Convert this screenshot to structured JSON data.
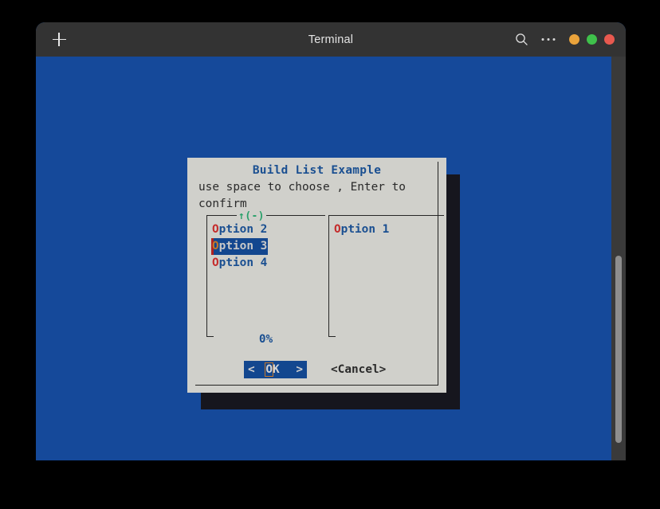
{
  "window": {
    "title": "Terminal",
    "new_tab_icon": "plus-icon",
    "search_icon": "search-icon",
    "menu_icon": "ellipsis-icon",
    "controls": [
      {
        "name": "minimize",
        "color": "#eaa33b"
      },
      {
        "name": "maximize",
        "color": "#3fc14b"
      },
      {
        "name": "close",
        "color": "#e8594f"
      }
    ],
    "background": "#15499a",
    "titlebar_background": "#333333"
  },
  "scrollbar": {
    "track_color": "#3a3a3a",
    "thumb_color": "#8e8e8e"
  },
  "dialog": {
    "title": "Build List Example",
    "prompt": "use space to choose , Enter to\nconfirm",
    "background": "#d0d0cb",
    "title_color": "#1a4f91",
    "left_pane": {
      "tag": "↑(-)",
      "tag_color": "#28a06a",
      "items": [
        {
          "hotkey": "O",
          "rest": "ption 2",
          "selected": false
        },
        {
          "hotkey": "O",
          "rest": "ption 3",
          "selected": true
        },
        {
          "hotkey": "O",
          "rest": "ption 4",
          "selected": false
        }
      ]
    },
    "right_pane": {
      "items": [
        {
          "hotkey": "O",
          "rest": "ption 1",
          "selected": false
        }
      ]
    },
    "percent": "0%",
    "buttons": {
      "ok": {
        "left_caret": "<",
        "hotkey": "O",
        "rest": "K",
        "right_caret": ">",
        "background": "#13478f"
      },
      "cancel": "<Cancel>"
    }
  }
}
